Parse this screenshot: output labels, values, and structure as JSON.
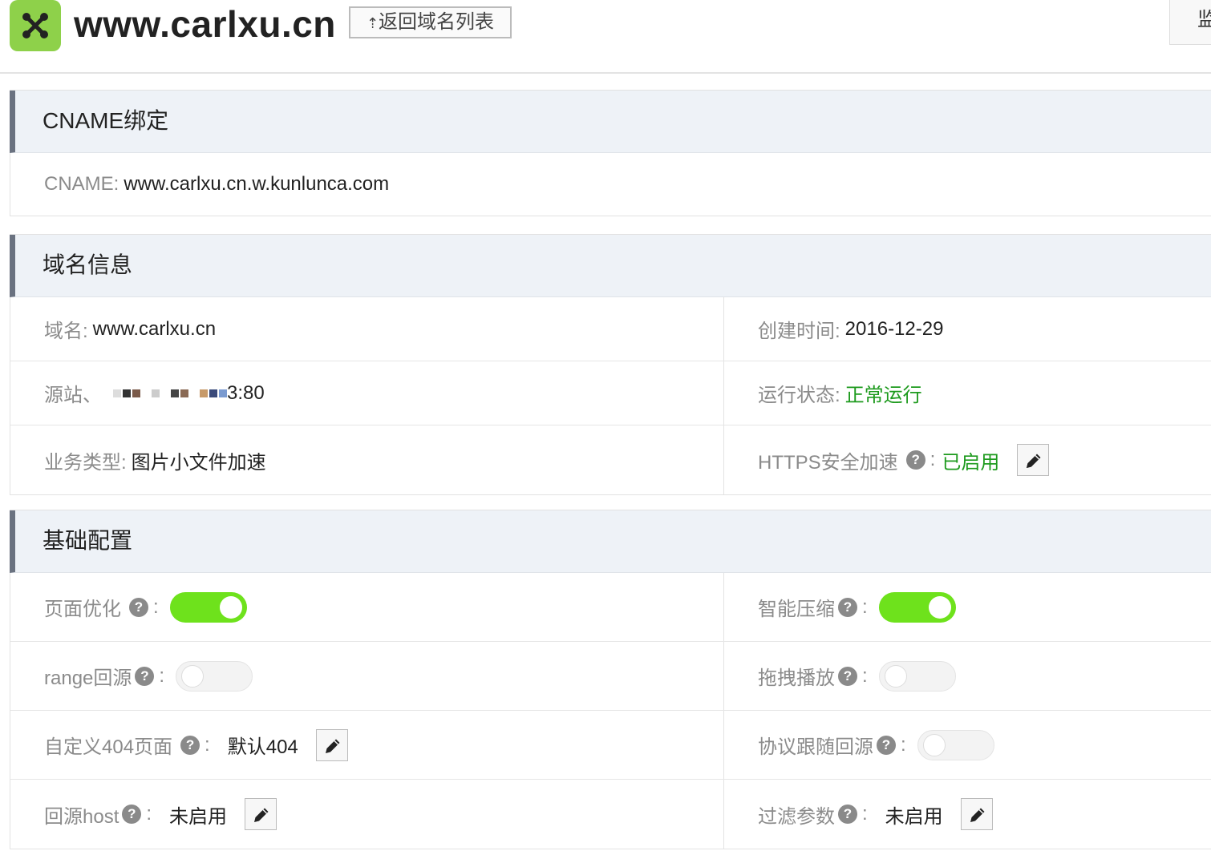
{
  "header": {
    "domain": "www.carlxu.cn",
    "back_label": "返回域名列表",
    "monitor_label": "监"
  },
  "cname_section": {
    "title": "CNAME绑定",
    "cname_label": "CNAME:",
    "cname_value": "www.carlxu.cn.w.kunlunca.com"
  },
  "info_section": {
    "title": "域名信息",
    "domain_label": "域名:",
    "domain_value": "www.carlxu.cn",
    "created_label": "创建时间:",
    "created_value": "2016-12-29",
    "origin_label": "源站",
    "origin_value": "3:80",
    "status_label": "运行状态:",
    "status_value": "正常运行",
    "type_label": "业务类型:",
    "type_value": "图片小文件加速",
    "https_label": "HTTPS安全加速",
    "https_value": "已启用"
  },
  "config_section": {
    "title": "基础配置",
    "items": {
      "page_opt": {
        "label": "页面优化",
        "enabled": true
      },
      "smart_compress": {
        "label": "智能压缩",
        "enabled": true
      },
      "range_origin": {
        "label": "range回源",
        "enabled": false
      },
      "drag_play": {
        "label": "拖拽播放",
        "enabled": false
      },
      "custom_404": {
        "label": "自定义404页面",
        "value": "默认404"
      },
      "protocol_follow": {
        "label": "协议跟随回源",
        "enabled": false
      },
      "origin_host": {
        "label": "回源host",
        "value": "未启用"
      },
      "filter_params": {
        "label": "过滤参数",
        "value": "未启用"
      }
    }
  },
  "colors": {
    "accent_green": "#6ee21c",
    "text_green": "#1d9a1d",
    "logo_green": "#8ed14a"
  },
  "icons": {
    "logo": "x-cross-icon",
    "edit": "pencil-icon",
    "help": "question-icon",
    "back": "upload-arrow-icon"
  }
}
